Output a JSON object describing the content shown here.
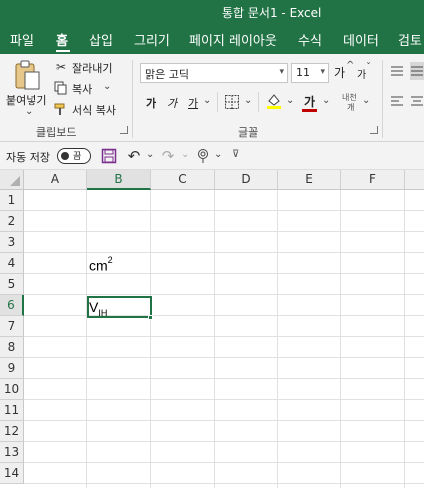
{
  "window": {
    "title": "통합 문서1  -  Excel"
  },
  "tabs": [
    "파일",
    "홈",
    "삽입",
    "그리기",
    "페이지 레이아웃",
    "수식",
    "데이터",
    "검토"
  ],
  "active_tab": "홈",
  "ribbon": {
    "clipboard": {
      "paste": "붙여넣기",
      "cut": "잘라내기",
      "copy": "복사",
      "format_painter": "서식 복사",
      "group_label": "클립보드"
    },
    "font": {
      "font_name": "맑은 고딕",
      "font_size": "11",
      "grow": "가",
      "shrink": "가",
      "bold": "가",
      "italic": "가",
      "underline": "가",
      "font_color_glyph": "가",
      "phonetic": "내천",
      "group_label": "글꼴",
      "fill_color": "#ffff00",
      "text_color": "#c00000"
    }
  },
  "qat": {
    "autosave": "자동 저장",
    "toggle_state": "끔"
  },
  "sheet": {
    "columns": [
      "A",
      "B",
      "C",
      "D",
      "E",
      "F"
    ],
    "rows": [
      "1",
      "2",
      "3",
      "4",
      "5",
      "6",
      "7",
      "8",
      "9",
      "10",
      "11",
      "12",
      "13",
      "14"
    ],
    "selected_column": "B",
    "selected_row": "6",
    "active_cell": "B6",
    "cells": {
      "B4": {
        "base": "cm",
        "sup": "2"
      },
      "B6": {
        "base": "V",
        "sub": "IH"
      }
    }
  },
  "colors": {
    "accent": "#217346"
  }
}
